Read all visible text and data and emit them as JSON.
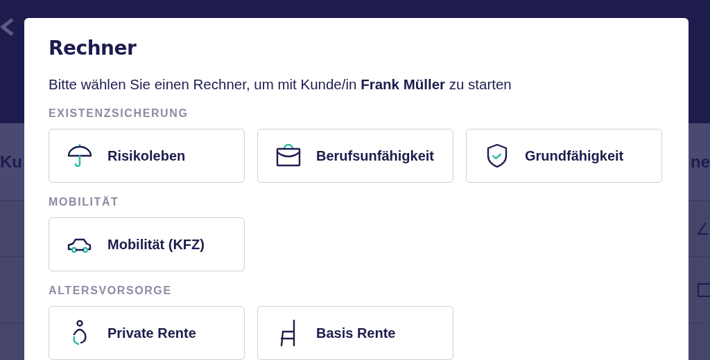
{
  "backdrop": {
    "header_left": "Ku",
    "header_right": "ne"
  },
  "dialog": {
    "title": "Rechner",
    "intro": "Bitte wählen Sie einen Rechner, um mit Kunde/in **Frank Müller** zu starten",
    "sections": [
      {
        "heading": "EXISTENZSICHERUNG",
        "calculators": [
          {
            "label": "Risikoleben",
            "kind": "umbrella"
          },
          {
            "label": "Berufsunfähigkeit",
            "kind": "briefcase"
          },
          {
            "label": "Grundfähigkeit",
            "kind": "shield"
          }
        ]
      },
      {
        "heading": "MOBILITÄT",
        "calculators": [
          {
            "label": "Mobilität (KFZ)",
            "kind": "car"
          }
        ]
      },
      {
        "heading": "ALTERSVORSORGE",
        "calculators": [
          {
            "label": "Private Rente",
            "kind": "person"
          },
          {
            "label": "Basis Rente",
            "kind": "chair"
          }
        ]
      }
    ]
  }
}
